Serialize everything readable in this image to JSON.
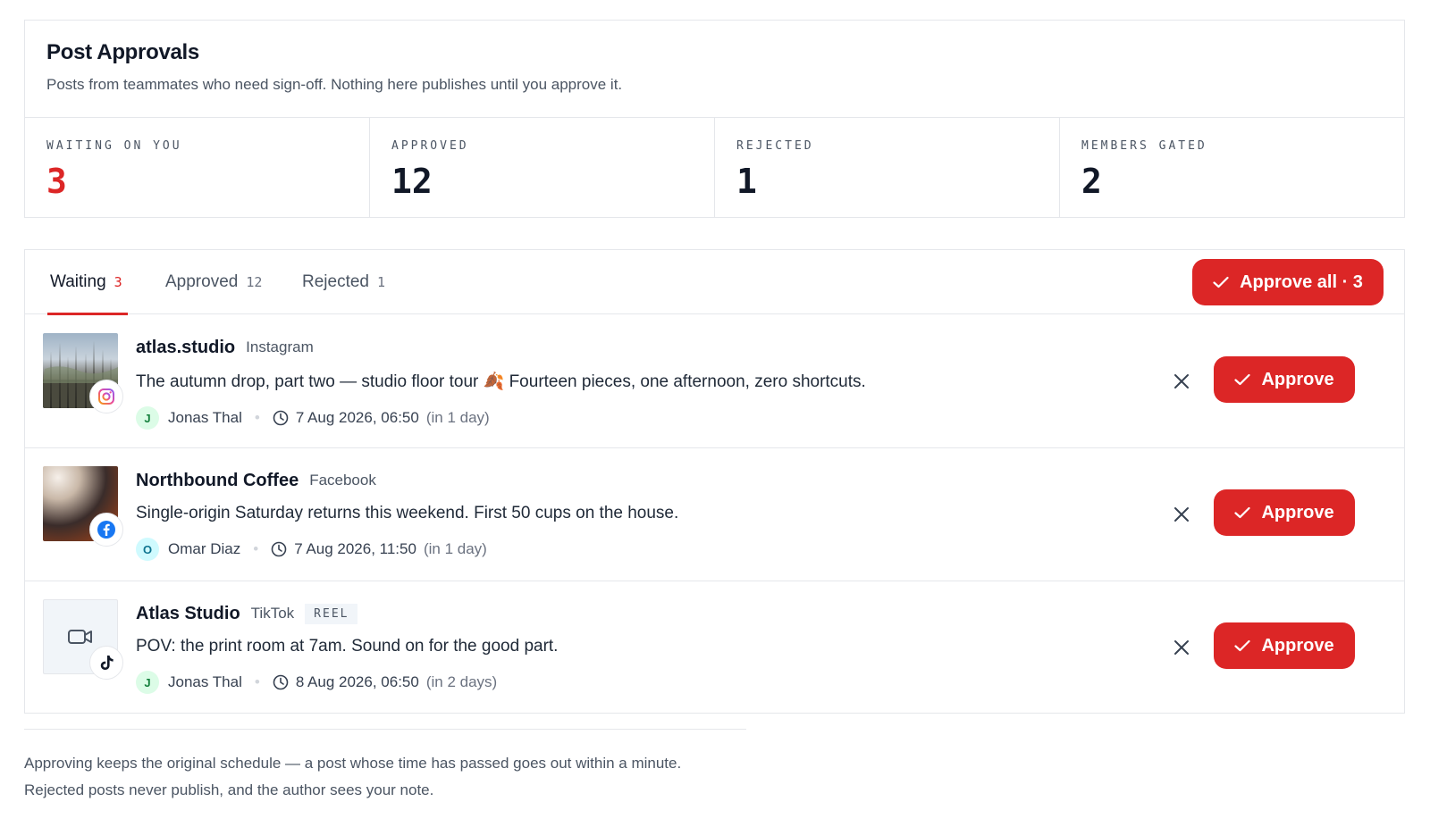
{
  "header": {
    "title": "Post Approvals",
    "subtitle": "Posts from teammates who need sign-off. Nothing here publishes until you approve it."
  },
  "stats": [
    {
      "label": "WAITING ON YOU",
      "value": "3"
    },
    {
      "label": "APPROVED",
      "value": "12"
    },
    {
      "label": "REJECTED",
      "value": "1"
    },
    {
      "label": "MEMBERS GATED",
      "value": "2"
    }
  ],
  "tabs": [
    {
      "label": "Waiting",
      "count": "3"
    },
    {
      "label": "Approved",
      "count": "12"
    },
    {
      "label": "Rejected",
      "count": "1"
    }
  ],
  "approve_all_label": "Approve all · 3",
  "posts": [
    {
      "account": "atlas.studio",
      "platform": "Instagram",
      "tag": "",
      "text": "The autumn drop, part two — studio floor tour 🍂 Fourteen pieces, one afternoon, zero shortcuts.",
      "author_initial": "J",
      "author": "Jonas Thal",
      "datetime": "7 Aug 2026, 06:50",
      "relative": "(in 1 day)",
      "approve_label": "Approve",
      "platform_icon": "instagram-icon"
    },
    {
      "account": "Northbound Coffee",
      "platform": "Facebook",
      "tag": "",
      "text": "Single-origin Saturday returns this weekend. First 50 cups on the house.",
      "author_initial": "O",
      "author": "Omar Diaz",
      "datetime": "7 Aug 2026, 11:50",
      "relative": "(in 1 day)",
      "approve_label": "Approve",
      "platform_icon": "facebook-icon"
    },
    {
      "account": "Atlas Studio",
      "platform": "TikTok",
      "tag": "REEL",
      "text": "POV: the print room at 7am. Sound on for the good part.",
      "author_initial": "J",
      "author": "Jonas Thal",
      "datetime": "8 Aug 2026, 06:50",
      "relative": "(in 2 days)",
      "approve_label": "Approve",
      "platform_icon": "tiktok-icon"
    }
  ],
  "footer": {
    "line1": "Approving keeps the original schedule — a post whose time has passed goes out within a minute.",
    "line2": "Rejected posts never publish, and the author sees your note."
  },
  "colors": {
    "accent": "#dc2626",
    "border": "#e5e7eb",
    "text": "#111827",
    "muted": "#4b5563"
  }
}
